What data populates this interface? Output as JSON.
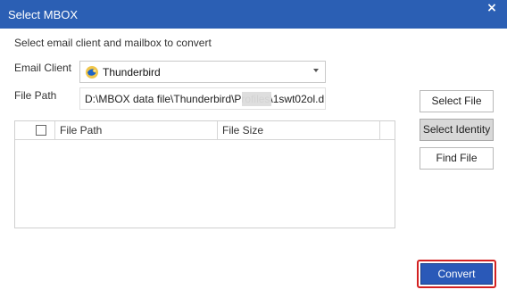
{
  "window": {
    "title": "Select MBOX",
    "close_icon": "×"
  },
  "form": {
    "instruction": "Select email client and mailbox to convert",
    "email_client_label": "Email Client",
    "email_client_value": "Thunderbird",
    "file_path_label": "File Path",
    "file_path_value": "D:\\MBOX data file\\Thunderbird\\Profiles\\1swt02ol.d"
  },
  "grid": {
    "headers": [
      "File Path",
      "File Size"
    ]
  },
  "buttons": {
    "select_file": "Select File",
    "select_identity": "Select Identity",
    "find_file": "Find File",
    "convert": "Convert"
  },
  "colors": {
    "titlebar": "#2b5fb4",
    "convert": "#2a59b8",
    "highlight_border": "#d32121"
  },
  "icons": {
    "email_client_icon": "thunderbird-icon",
    "dropdown_icon": "chevron-down-icon"
  }
}
